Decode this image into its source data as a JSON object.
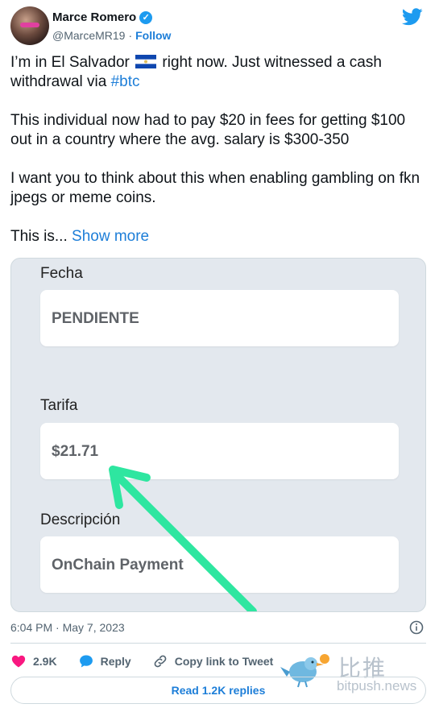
{
  "author": {
    "name": "Marce Romero",
    "handle": "@MarceMR19",
    "separator": "·",
    "follow_label": "Follow"
  },
  "tweet": {
    "p1_a": "I’m in El Salvador ",
    "p1_b": " right now. Just witnessed a cash withdrawal via ",
    "hashtag": "#btc",
    "p2": "This individual now had to pay $20 in fees for getting $100 out in a country where the avg. salary is $300-350",
    "p3": "I want you to think about this when enabling gambling on fkn jpegs or meme coins.",
    "p4": "This is... ",
    "show_more": "Show more"
  },
  "media": {
    "fields": [
      {
        "label": "Fecha",
        "value": "PENDIENTE"
      },
      {
        "label": "Tarifa",
        "value": "$21.71"
      },
      {
        "label": "Descripción",
        "value": "OnChain Payment"
      }
    ],
    "arrow_color": "#2ee6a0"
  },
  "meta": {
    "time": "6:04 PM",
    "separator": "·",
    "date": "May 7, 2023"
  },
  "actions": {
    "likes": "2.9K",
    "reply": "Reply",
    "copy_link": "Copy link to Tweet",
    "read_replies": "Read 1.2K replies"
  },
  "watermark": {
    "cn": "比推",
    "en": "bitpush.news"
  },
  "colors": {
    "accent": "#1d9bf0",
    "link": "#1d7ed8",
    "heart": "#f91880"
  }
}
